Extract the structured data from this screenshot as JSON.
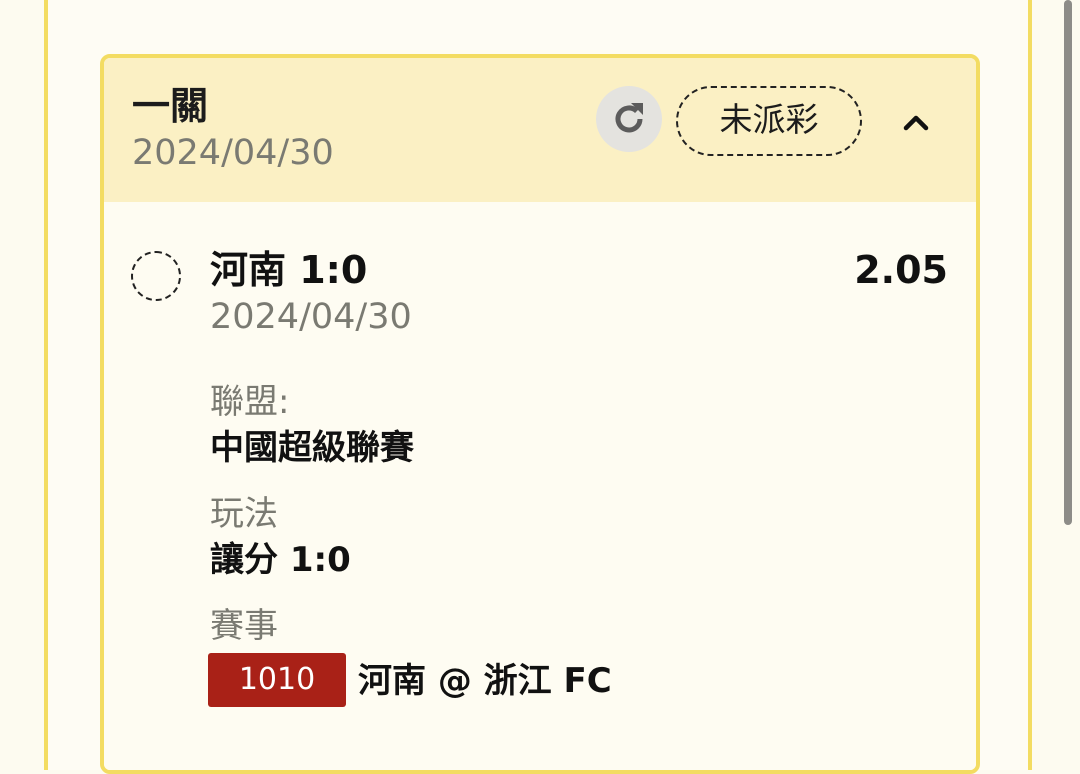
{
  "bet": {
    "type": "一關",
    "date": "2024/04/30",
    "status": "未派彩"
  },
  "selection": {
    "title": "河南 1:0",
    "odds": "2.05",
    "date": "2024/04/30"
  },
  "details": {
    "league_label": "聯盟:",
    "league_value": "中國超級聯賽",
    "play_label": "玩法",
    "play_value": "讓分 1:0",
    "event_label": "賽事",
    "match_code": "1010",
    "match_name": "河南 @ 浙江 FC"
  },
  "icons": {
    "refresh": "refresh-icon",
    "collapse": "chevron-up-icon",
    "radio": "unselected-radio-icon"
  },
  "colors": {
    "accent_border": "#f3dc62",
    "header_bg": "#fbf0c4",
    "code_badge": "#a92117"
  }
}
